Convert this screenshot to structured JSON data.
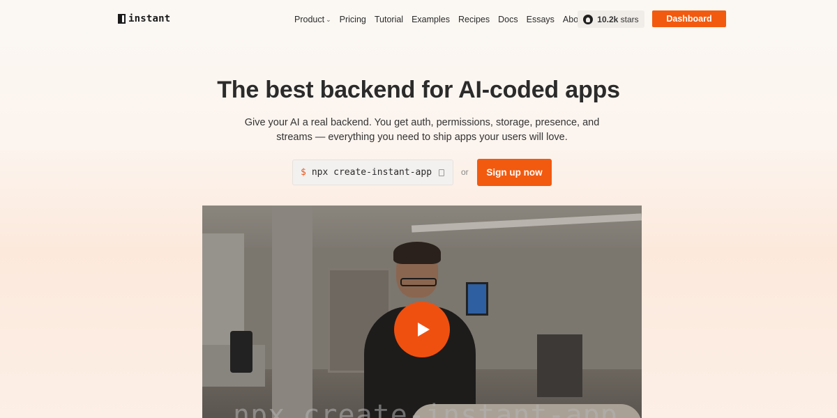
{
  "brand": {
    "name": "instant"
  },
  "nav": {
    "links": [
      {
        "label": "Product",
        "has_dropdown": true
      },
      {
        "label": "Pricing"
      },
      {
        "label": "Tutorial"
      },
      {
        "label": "Examples"
      },
      {
        "label": "Recipes"
      },
      {
        "label": "Docs"
      },
      {
        "label": "Essays"
      },
      {
        "label": "About"
      }
    ],
    "github": {
      "icon": "github-icon",
      "count": "10.2k",
      "suffix": "stars"
    },
    "dashboard_label": "Dashboard"
  },
  "hero": {
    "title": "The best backend for AI-coded apps",
    "subtitle": "Give your AI a real backend. You get auth, permissions, storage, presence, and streams — everything you need to ship apps your users will love.",
    "command": {
      "prompt": "$",
      "text": "npx create-instant-app",
      "icon": "copy-icon"
    },
    "or_label": "or",
    "signup_label": "Sign up now"
  },
  "video": {
    "play_icon": "play-icon",
    "overlay_text": "npx create-instant-app"
  },
  "colors": {
    "accent": "#f25a0f",
    "text": "#2b2b2b",
    "github_bg": "#f0ede9"
  }
}
